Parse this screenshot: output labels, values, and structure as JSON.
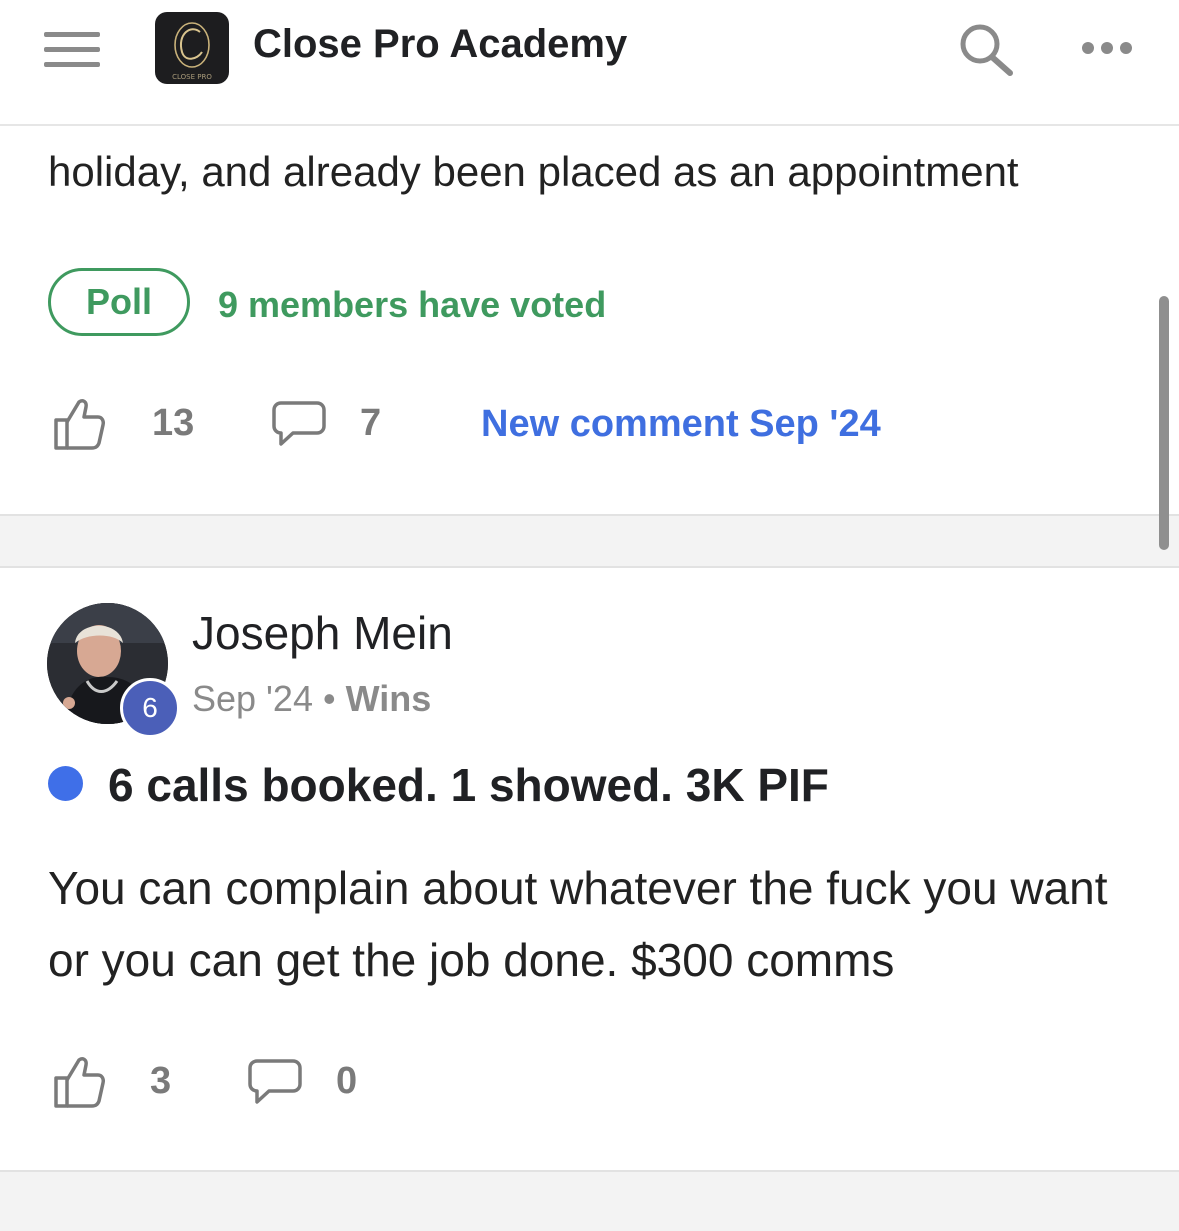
{
  "header": {
    "title": "Close Pro Academy",
    "logo_text": "CLOSE PRO",
    "menu_icon": "hamburger-menu-icon",
    "search_icon": "search-icon",
    "more_icon": "more-horizontal-icon"
  },
  "post1": {
    "visible_text": "holiday, and already been placed as an appointment",
    "poll": {
      "label": "Poll",
      "votes_text": "9 members have voted"
    },
    "likes": "13",
    "comments": "7",
    "new_comment": "New comment Sep '24"
  },
  "post2": {
    "author": "Joseph Mein",
    "level": "6",
    "date": "Sep '24",
    "separator": "•",
    "category": "Wins",
    "title": "6 calls booked. 1 showed. 3K PIF",
    "body": "You can complain about whatever the fuck you want or you can get the job done. $300 comms",
    "likes": "3",
    "comments": "0"
  },
  "colors": {
    "poll_green": "#3f9a5f",
    "link_blue": "#3f6fe0",
    "unread_dot": "#3f6fe8",
    "level_badge": "#4b5fb8"
  }
}
